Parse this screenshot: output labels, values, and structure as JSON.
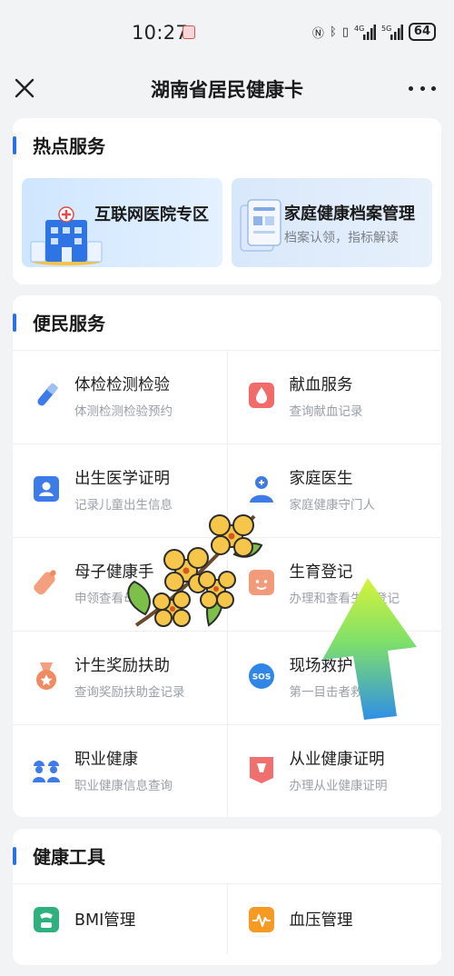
{
  "status": {
    "time": "10:27",
    "network": "4G 5G",
    "battery": "64"
  },
  "header": {
    "title": "湖南省居民健康卡"
  },
  "hot_services": {
    "heading": "热点服务",
    "items": [
      {
        "title": "互联网医院专区",
        "subtitle": ""
      },
      {
        "title": "家庭健康档案管理",
        "subtitle": "档案认领，指标解读"
      }
    ]
  },
  "convenience": {
    "heading": "便民服务",
    "items": [
      {
        "label": "体检检测检验",
        "sub": "体测检测检验预约",
        "icon": "test-tube-icon"
      },
      {
        "label": "献血服务",
        "sub": "查询献血记录",
        "icon": "blood-drop-icon"
      },
      {
        "label": "出生医学证明",
        "sub": "记录儿童出生信息",
        "icon": "id-card-icon"
      },
      {
        "label": "家庭医生",
        "sub": "家庭健康守门人",
        "icon": "doctor-icon"
      },
      {
        "label": "母子健康手",
        "sub": "申领查看母子",
        "icon": "baby-bottle-icon"
      },
      {
        "label": "生育登记",
        "sub": "办理和查看生育登记",
        "icon": "baby-face-icon"
      },
      {
        "label": "计生奖励扶助",
        "sub": "查询奖励扶助金记录",
        "icon": "medal-icon"
      },
      {
        "label": "现场救护",
        "sub": "第一目击者救护",
        "icon": "sos-icon"
      },
      {
        "label": "职业健康",
        "sub": "职业健康信息查询",
        "icon": "workers-icon"
      },
      {
        "label": "从业健康证明",
        "sub": "办理从业健康证明",
        "icon": "certificate-icon"
      }
    ]
  },
  "health_tools": {
    "heading": "健康工具",
    "items": [
      {
        "label": "BMI管理",
        "icon": "scale-icon"
      },
      {
        "label": "血压管理",
        "icon": "blood-pressure-icon"
      }
    ]
  },
  "colors": {
    "accent": "#2f6fe4",
    "background": "#f2f3f5",
    "card": "#ffffff"
  }
}
